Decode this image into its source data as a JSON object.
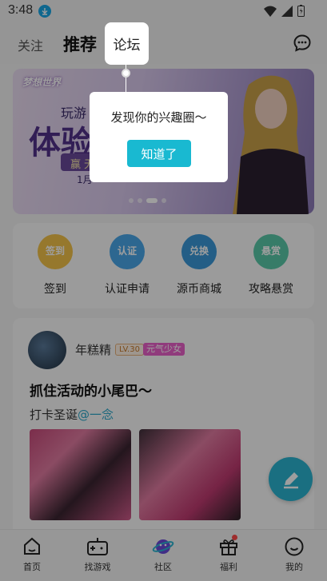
{
  "status_bar": {
    "time": "3:48"
  },
  "top_nav": {
    "tabs": [
      {
        "label": "关注"
      },
      {
        "label": "推荐"
      },
      {
        "label": "论坛"
      }
    ]
  },
  "banner": {
    "logo": "梦想世界",
    "play": "玩游",
    "headline": "体验",
    "subtitle": "赢 无 ",
    "date": "1月"
  },
  "quick_actions": [
    {
      "label": "签到",
      "icon_text": "签到",
      "color": "#f2c24a"
    },
    {
      "label": "认证申请",
      "icon_text": "认证",
      "color": "#4aa6e8"
    },
    {
      "label": "源币商城",
      "icon_text": "兑换",
      "color": "#3a98d8"
    },
    {
      "label": "攻略悬赏",
      "icon_text": "悬赏",
      "color": "#5ac8a8"
    }
  ],
  "post": {
    "author": "年糕精",
    "level": "LV.30",
    "tag": "元气少女",
    "title": "抓住活动的小尾巴～",
    "text": "打卡圣诞",
    "mention": "@一念"
  },
  "tooltip": {
    "message": "发现你的兴趣圈～",
    "button": "知道了"
  },
  "bottom_nav": [
    {
      "label": "首页",
      "icon": "home-icon"
    },
    {
      "label": "找游戏",
      "icon": "gamepad-icon"
    },
    {
      "label": "社区",
      "icon": "planet-icon"
    },
    {
      "label": "福利",
      "icon": "gift-icon"
    },
    {
      "label": "我的",
      "icon": "smile-icon"
    }
  ],
  "colors": {
    "accent": "#19b9d1",
    "fab": "#2ab3d0",
    "mention": "#2aa7c9",
    "tag": "#e860c8"
  }
}
